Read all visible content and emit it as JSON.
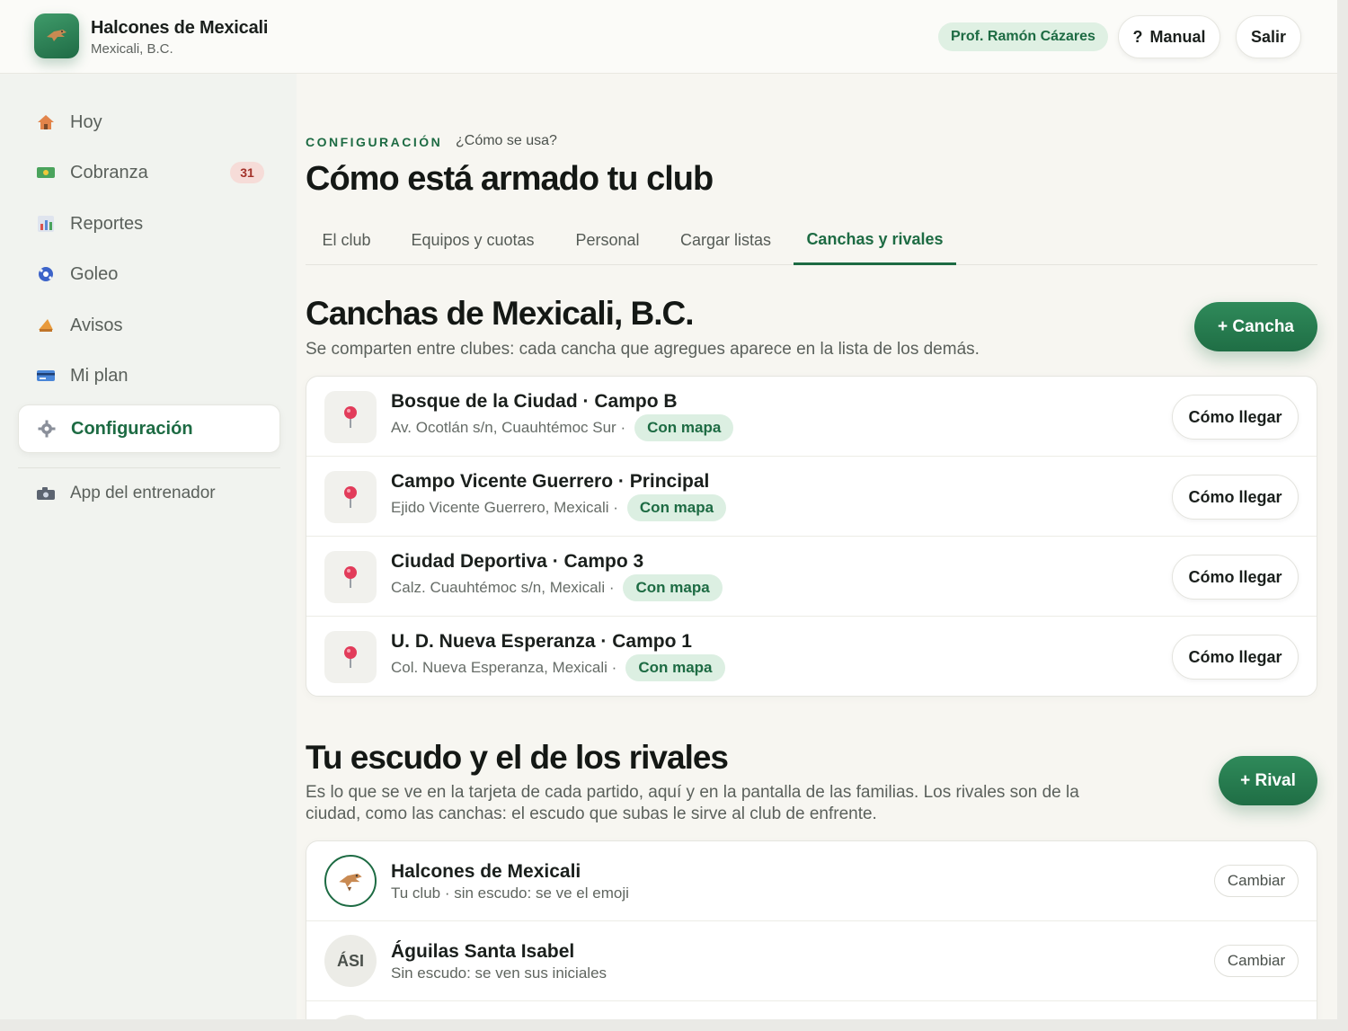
{
  "header": {
    "club_name": "Halcones de Mexicali",
    "club_city": "Mexicali, B.C.",
    "logo_icon": "hawk-icon",
    "coach": "Prof. Ramón Cázares",
    "manual_icon": "?",
    "manual_label": "Manual",
    "logout_label": "Salir"
  },
  "sidebar": {
    "items": [
      {
        "label": "Hoy",
        "icon": "house-icon"
      },
      {
        "label": "Cobranza",
        "icon": "money-icon",
        "badge": "31"
      },
      {
        "label": "Reportes",
        "icon": "bar-chart-icon"
      },
      {
        "label": "Goleo",
        "icon": "soccer-ball-icon"
      },
      {
        "label": "Avisos",
        "icon": "megaphone-icon"
      },
      {
        "label": "Mi plan",
        "icon": "credit-card-icon"
      },
      {
        "label": "Configuración",
        "icon": "gear-icon",
        "active": true
      }
    ],
    "app_link": {
      "label": "App del entrenador",
      "icon": "camera-icon"
    }
  },
  "main": {
    "eyebrow": "CONFIGURACIÓN",
    "help_link": "¿Cómo se usa?",
    "title": "Cómo está armado tu club",
    "tabs": [
      {
        "label": "El club"
      },
      {
        "label": "Equipos y cuotas"
      },
      {
        "label": "Personal"
      },
      {
        "label": "Cargar listas"
      },
      {
        "label": "Canchas y rivales",
        "active": true
      }
    ]
  },
  "fields": {
    "title": "Canchas de Mexicali, B.C.",
    "subtitle": "Se comparten entre clubes: cada cancha que agregues aparece en la lista de los demás.",
    "add_label": "+ Cancha",
    "route_label": "Cómo llegar",
    "map_label": "Con mapa",
    "items": [
      {
        "name": "Bosque de la Ciudad · Campo B",
        "address": "Av. Ocotlán s/n, Cuauhtémoc Sur ·"
      },
      {
        "name": "Campo Vicente Guerrero · Principal",
        "address": "Ejido Vicente Guerrero, Mexicali ·"
      },
      {
        "name": "Ciudad Deportiva · Campo 3",
        "address": "Calz. Cuauhtémoc s/n, Mexicali ·"
      },
      {
        "name": "U. D. Nueva Esperanza · Campo 1",
        "address": "Col. Nueva Esperanza, Mexicali ·"
      }
    ]
  },
  "rivals": {
    "title": "Tu escudo y el de los rivales",
    "subtitle_1": "Es lo que se ve en la tarjeta de cada partido, aquí y en la pantalla de las familias. Los rivales son de la",
    "subtitle_2": "ciudad, como las canchas: el escudo que subas le sirve al club de enfrente.",
    "add_label": "+ Rival",
    "change_label": "Cambiar",
    "teams": [
      {
        "name": "Halcones de Mexicali",
        "detail": "Tu club · sin escudo: se ve el emoji",
        "crest": "hawk-icon"
      },
      {
        "name": "Águilas Santa Isabel",
        "detail": "Sin escudo: se ven sus iniciales",
        "initials": "ÁSI"
      }
    ]
  },
  "colors": {
    "brand_green": "#1d6b43",
    "pill_green": "#dcefe2",
    "badge_red": "#a3322a",
    "badge_bg": "#f6dcd8"
  }
}
